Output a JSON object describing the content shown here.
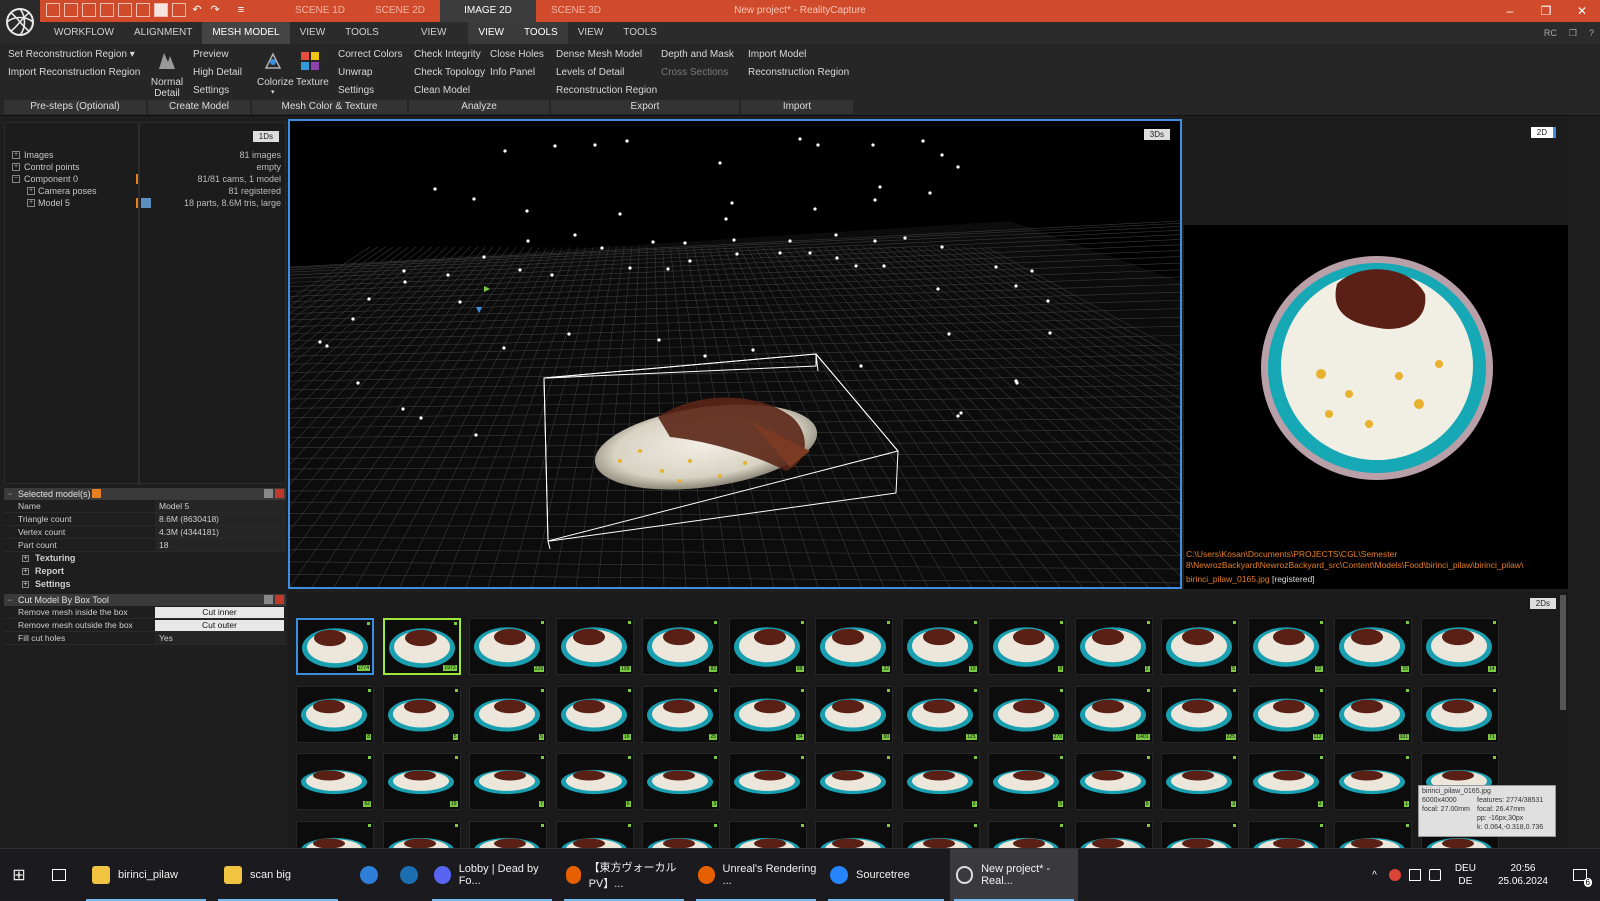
{
  "titlebar": {
    "window_title": "New project* - RealityCapture",
    "scene_tabs": [
      "SCENE 1D",
      "SCENE 2D",
      "IMAGE 2D",
      "SCENE 3D"
    ],
    "active_scene_tab": "IMAGE 2D",
    "minimize": "–",
    "maximize": "❐",
    "close": "✕",
    "qat_more": "≡"
  },
  "menubar": {
    "items": [
      "WORKFLOW",
      "ALIGNMENT",
      "MESH MODEL",
      "VIEW",
      "TOOLS",
      "VIEW",
      "VIEW",
      "TOOLS",
      "VIEW",
      "TOOLS"
    ],
    "right": [
      "RC",
      "❐",
      "?"
    ]
  },
  "ribbon": {
    "presteps": {
      "label": "Pre-steps (Optional)",
      "set_region": "Set Reconstruction Region ▾",
      "import_region": "Import Reconstruction Region"
    },
    "create_model": {
      "label": "Create Model",
      "normal_detail": "Normal Detail",
      "preview": "Preview",
      "high_detail": "High Detail",
      "settings": "Settings"
    },
    "mesh_color": {
      "label": "Mesh Color & Texture",
      "colorize": "Colorize",
      "texture": "Texture",
      "correct_colors": "Correct Colors",
      "unwrap": "Unwrap",
      "settings": "Settings"
    },
    "analyze": {
      "label": "Analyze",
      "check_integrity": "Check Integrity",
      "check_topology": "Check Topology",
      "clean_model": "Clean Model",
      "close_holes": "Close Holes",
      "info_panel": "Info Panel"
    },
    "export": {
      "label": "Export",
      "dense_mesh": "Dense Mesh Model",
      "levels_of_detail": "Levels of Detail",
      "reconstruction_region": "Reconstruction Region",
      "depth_and_mask": "Depth and Mask",
      "cross_sections": "Cross Sections"
    },
    "import": {
      "label": "Import",
      "import_model": "Import Model",
      "reconstruction_region": "Reconstruction Region"
    }
  },
  "tree": {
    "badge": "1Ds",
    "rows": [
      {
        "name": "Images",
        "value": "81 images"
      },
      {
        "name": "Control points",
        "value": "empty"
      },
      {
        "name": "Component 0",
        "value": "81/81 cams, 1 model"
      },
      {
        "name": "Camera poses",
        "value": "81 registered"
      },
      {
        "name": "Model 5",
        "value": "18 parts, 8.6M tris, large"
      }
    ]
  },
  "selected_model": {
    "title": "Selected model(s)",
    "rows": [
      {
        "key": "Name",
        "value": "Model 5"
      },
      {
        "key": "Triangle count",
        "value": "8.6M (8630418)"
      },
      {
        "key": "Vertex count",
        "value": "4.3M (4344181)"
      },
      {
        "key": "Part count",
        "value": "18"
      }
    ],
    "sections": [
      "Texturing",
      "Report",
      "Settings"
    ]
  },
  "cut_tool": {
    "title": "Cut Model By Box Tool",
    "remove_inside": "Remove mesh inside the box",
    "cut_inner": "Cut inner",
    "remove_outside": "Remove mesh outside the box",
    "cut_outer": "Cut outer",
    "fill_holes": "Fill cut holes",
    "fill_value": "Yes"
  },
  "viewport3d": {
    "badge": "3Ds"
  },
  "panel2d": {
    "badge": "2D",
    "path": "C:\\Users\\Kosan\\Documents\\PROJECTS\\CGL\\Semester 8\\NewrozBackyard\\NewrozBackyard_src\\Content\\Models\\Food\\birinci_pilaw\\birinci_pilaw\\",
    "file": "birinci_pilaw_0165.jpg",
    "status": "[registered]"
  },
  "thumbs": {
    "badge": "2Ds",
    "row1_nums": [
      "2774",
      "1973",
      "229",
      "199",
      "82",
      "88",
      "22",
      "10",
      "8",
      "2",
      "5",
      "22",
      "15",
      "14"
    ],
    "row2_nums": [
      "8",
      "5",
      "5",
      "16",
      "25",
      "34",
      "50",
      "125",
      "270",
      "1401",
      "225",
      "112",
      "101",
      "71"
    ],
    "row3_nums": [
      "62",
      "19",
      "7",
      "6",
      "3",
      "",
      "",
      "2",
      "5",
      "5",
      "3",
      "2",
      "1",
      ""
    ]
  },
  "tooltip": {
    "file": "birinci_pilaw_0165.jpg",
    "size": "6000x4000",
    "features": "features: 2774/38531",
    "focal_mm": "focal: 27.00mm",
    "focal_eq": "focal: 26.47mm",
    "pp": "pp: -16px,30px",
    "k": "k: 0.064,-0.318,0.736"
  },
  "taskbar": {
    "items": [
      "birinci_pilaw",
      "scan big",
      "Lobby | Dead by Fo...",
      "【東方ヴォーカルPV】...",
      "Unreal's Rendering ...",
      "Sourcetree",
      "New project* - Real..."
    ],
    "lang": "DEU",
    "lang2": "DE",
    "time": "20:56",
    "date": "25.06.2024",
    "notif": "6",
    "start": "⊞"
  },
  "colors": {
    "accent": "#cf4b2b",
    "selection": "#3b8fe0",
    "highlight": "#7ac943",
    "path": "#e67e22"
  }
}
